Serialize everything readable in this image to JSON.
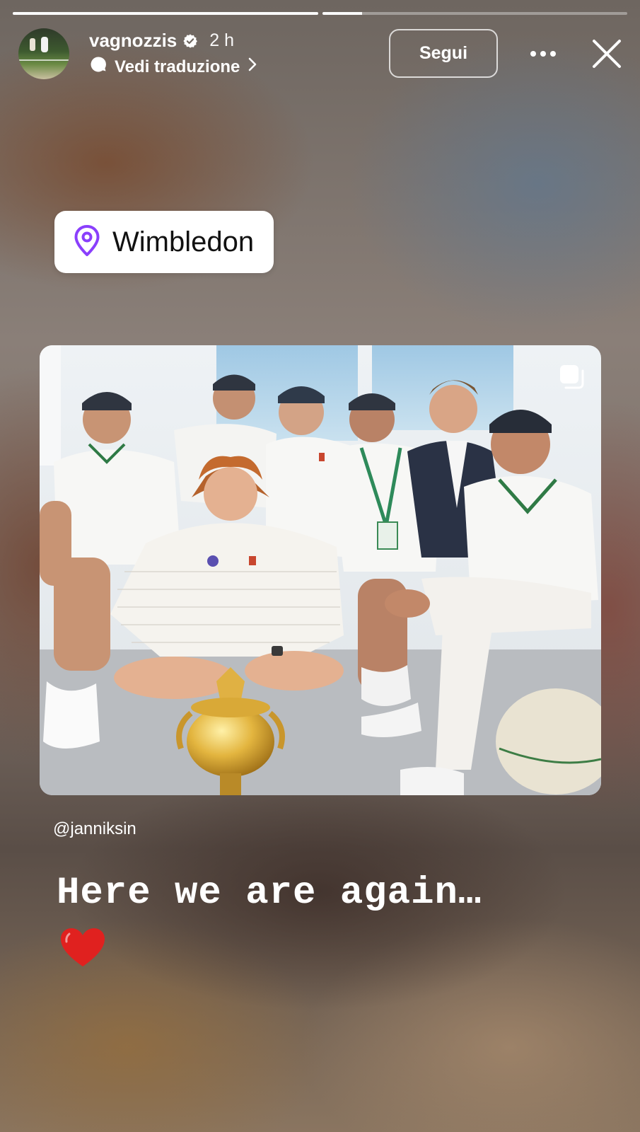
{
  "story": {
    "progress": [
      1.0,
      0.13
    ]
  },
  "header": {
    "username": "vagnozzis",
    "time": "2 h",
    "translate_label": "Vedi traduzione",
    "follow_label": "Segui"
  },
  "location_sticker": {
    "label": "Wimbledon"
  },
  "mention": {
    "label": "@janniksin"
  },
  "caption": {
    "text": "Here we are again…"
  },
  "colors": {
    "location_pin": "#8a3ffc",
    "heart": "#e0211f"
  },
  "icons": [
    "verified-icon",
    "translate-bubble-icon",
    "chevron-right-icon",
    "more-icon",
    "close-icon",
    "location-pin-icon",
    "carousel-icon",
    "heart-emoji"
  ]
}
